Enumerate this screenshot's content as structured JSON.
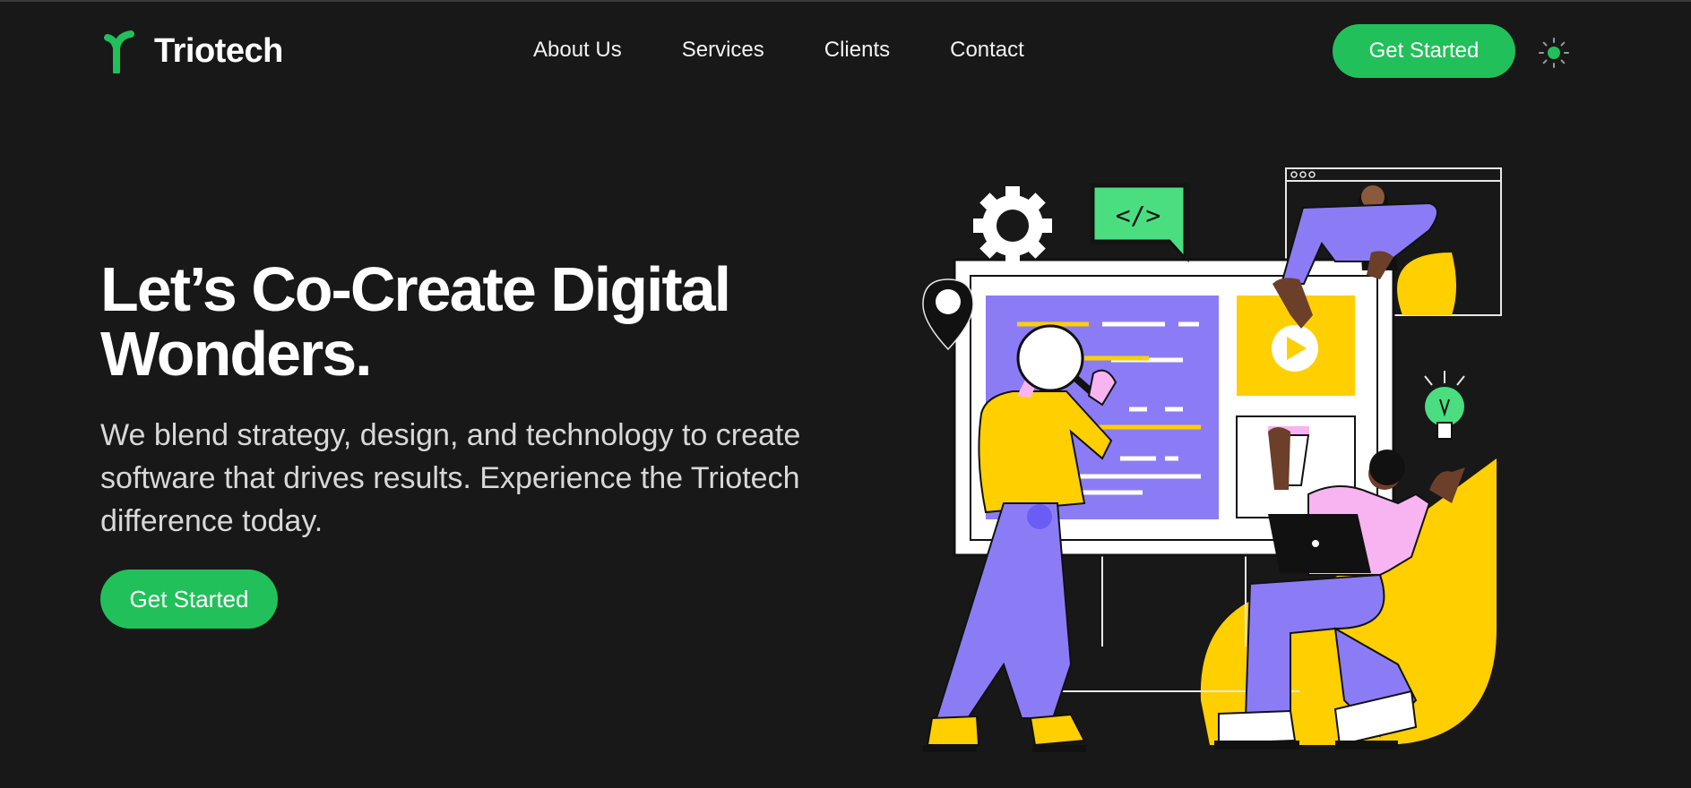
{
  "nav": {
    "brand": "Triotech",
    "links": [
      "About Us",
      "Services",
      "Clients",
      "Contact"
    ],
    "cta": "Get Started",
    "theme_icon": "sun-icon"
  },
  "hero": {
    "title_line1": "Let’s Co-Create Digital",
    "title_line2": "Wonders.",
    "subtitle": "We blend strategy, design, and technology to create software that drives results. Experience the Triotech difference today.",
    "cta": "Get Started",
    "code_tag": "</>"
  },
  "colors": {
    "background": "#181818",
    "accent": "#22c05a",
    "purple": "#8b7cf6",
    "yellow": "#ffcf00",
    "pink": "#f8b4f0"
  }
}
